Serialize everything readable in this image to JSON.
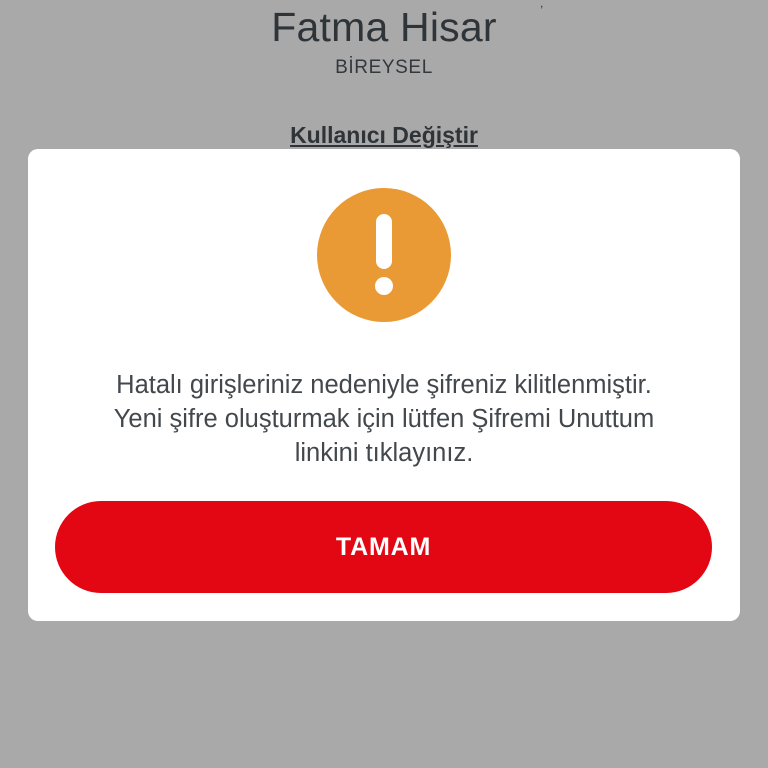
{
  "header": {
    "user_name": "Fatma Hisar",
    "user_type": "BİREYSEL",
    "switch_user_link": "Kullanıcı Değiştir"
  },
  "dialog": {
    "icon": "exclamation-icon",
    "message": "Hatalı girişleriniz nedeniyle şifreniz kilitlenmiştir.\nYeni şifre oluşturmak için lütfen Şifremi Unuttum\nlinkini tıklayınız.",
    "ok_button_label": "TAMAM"
  },
  "colors": {
    "overlay_background": "#a9a9a9",
    "dialog_background": "#ffffff",
    "warning_icon": "#ea9a35",
    "primary_button": "#e30613",
    "text": "#43484c"
  }
}
